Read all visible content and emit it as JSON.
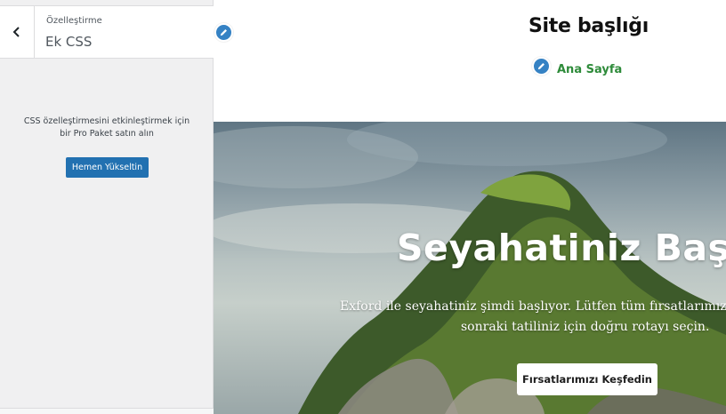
{
  "sidebar": {
    "back_icon": "chevron-left-icon",
    "parent_label": "Özelleştirme",
    "section_title": "Ek CSS",
    "upgrade_message_line1": "CSS özelleştirmesini etkinleştirmek için",
    "upgrade_message_line2": "bir Pro Paket satın alın",
    "upgrade_button_label": "Hemen Yükseltin"
  },
  "preview": {
    "site_title": "Site başlığı",
    "nav_home": "Ana Sayfa",
    "edit_icon": "pencil-icon",
    "hero": {
      "title": "Seyahatiniz Başlıyor",
      "description_line1": "Exford ile seyahatiniz şimdi başlıyor. Lütfen tüm fırsatlarımızı",
      "description_line2": "sonraki tatiliniz için doğru rotayı seçin.",
      "cta_label": "Fırsatlarımızı Keşfedin"
    }
  },
  "colors": {
    "accent": "#2271b1",
    "edit_shortcut": "#3582c4",
    "nav_link": "#2e8b3a"
  }
}
